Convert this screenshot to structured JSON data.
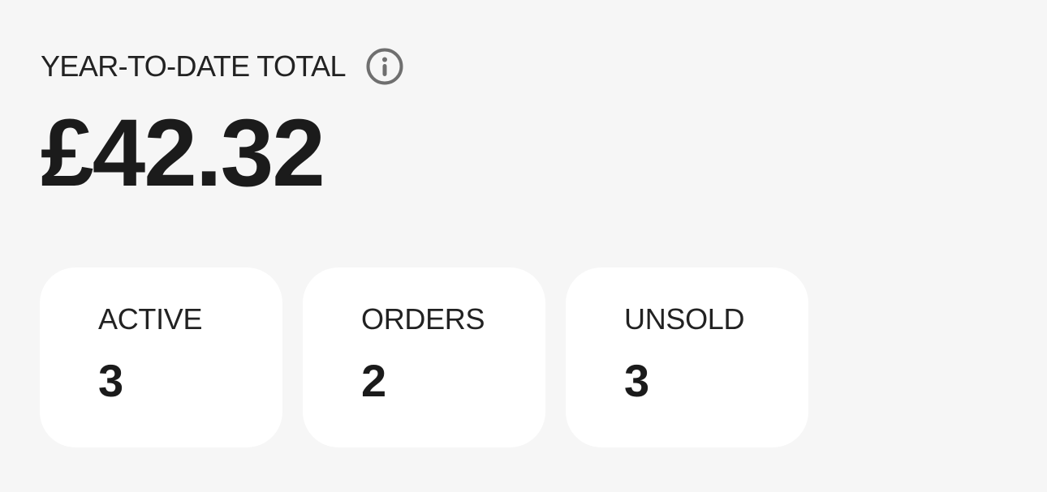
{
  "summary": {
    "label": "YEAR-TO-DATE TOTAL",
    "info_icon": "info-icon",
    "total": "£42.32"
  },
  "stats": [
    {
      "label": "ACTIVE",
      "value": "3"
    },
    {
      "label": "ORDERS",
      "value": "2"
    },
    {
      "label": "UNSOLD",
      "value": "3"
    }
  ],
  "colors": {
    "background": "#f6f6f6",
    "card": "#ffffff",
    "text": "#1b1b1b",
    "icon": "#6f6f6f"
  }
}
